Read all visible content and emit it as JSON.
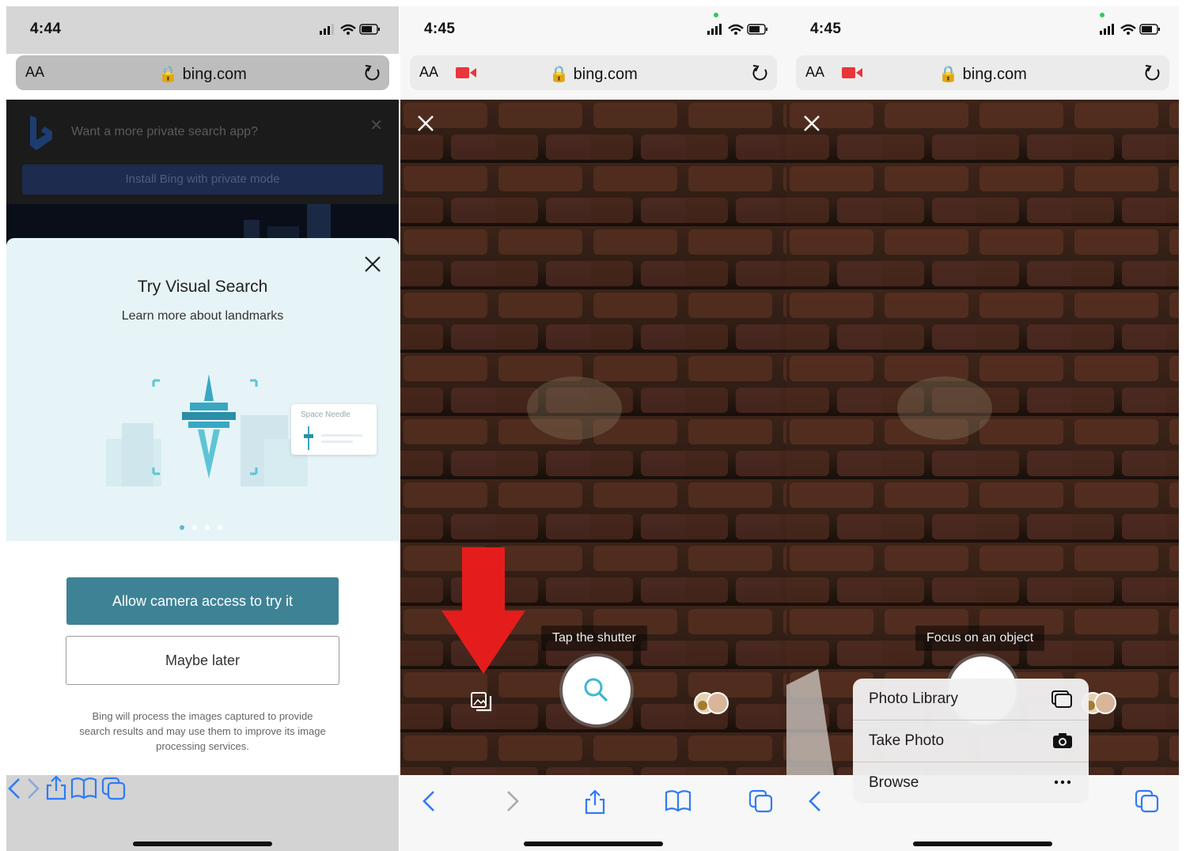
{
  "screens": [
    {
      "time": "4:44",
      "url_host": "bing.com",
      "text_size_label": "AA",
      "banner": {
        "message": "Want a more private search app?",
        "install_label": "Install Bing with private mode"
      },
      "sheet": {
        "title": "Try Visual Search",
        "subtitle": "Learn more about landmarks",
        "card_label": "Space Needle",
        "page_count": 4,
        "active_page": 1
      },
      "allow_button": "Allow camera access to try it",
      "later_button": "Maybe later",
      "disclaimer": "Bing will process the images captured to provide search results and may use them to improve its image processing services."
    },
    {
      "time": "4:45",
      "url_host": "bing.com",
      "text_size_label": "AA",
      "hint": "Tap the shutter"
    },
    {
      "time": "4:45",
      "url_host": "bing.com",
      "text_size_label": "AA",
      "hint": "Focus on an object",
      "menu": [
        {
          "label": "Photo Library",
          "icon": "photo-library-icon"
        },
        {
          "label": "Take Photo",
          "icon": "camera-icon"
        },
        {
          "label": "Browse",
          "icon": "ellipsis-icon"
        }
      ]
    }
  ],
  "colors": {
    "accent_blue": "#2f7bf5",
    "teal_button": "#3e8296",
    "red_arrow": "#e51c1c",
    "camera_red": "#e8363a"
  }
}
